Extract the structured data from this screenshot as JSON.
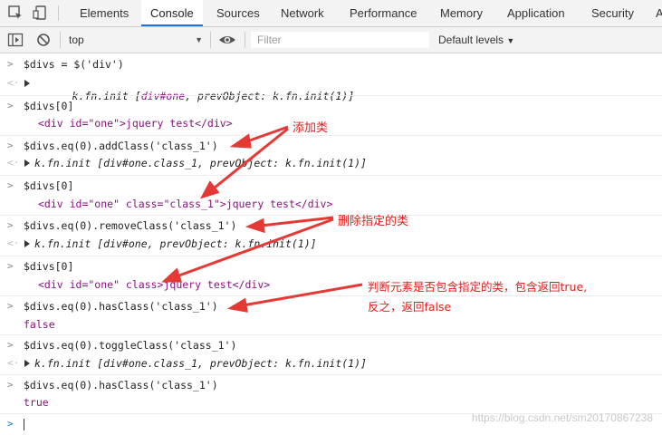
{
  "tabs": [
    "Elements",
    "Console",
    "Sources",
    "Network",
    "Performance",
    "Memory",
    "Application",
    "Security",
    "A"
  ],
  "toolbar": {
    "context": "top",
    "filter_placeholder": "Filter",
    "levels": "Default levels"
  },
  "console": {
    "l1": "$divs = $('div')",
    "l2a": "k.fn.init [",
    "l2b": "div#one",
    "l2c": ", prevObject: k.fn.init(1)]",
    "l3": "$divs[0]",
    "l4": "<div id=\"one\">jquery test</div>",
    "l5": "$divs.eq(0).addClass('class_1')",
    "l6": "k.fn.init [div#one.class_1, prevObject: k.fn.init(1)]",
    "l7": "$divs[0]",
    "l8": "<div id=\"one\" class=\"class_1\">jquery test</div>",
    "l9": "$divs.eq(0).removeClass('class_1')",
    "l10": "k.fn.init [div#one, prevObject: k.fn.init(1)]",
    "l11": "$divs[0]",
    "l12": "<div id=\"one\" class>jquery test</div>",
    "l13": "$divs.eq(0).hasClass('class_1')",
    "l14": "false",
    "l15": "$divs.eq(0).toggleClass('class_1')",
    "l16": "k.fn.init [div#one.class_1, prevObject: k.fn.init(1)]",
    "l17": "$divs.eq(0).hasClass('class_1')",
    "l18": "true"
  },
  "annotations": {
    "a1": "添加类",
    "a2": "删除指定的类",
    "a3_line1": "判断元素是否包含指定的类，包含返回true,",
    "a3_line2": "反之，返回false"
  },
  "watermark": "https://blog.csdn.net/sm20170867238",
  "colors": {
    "annotation": "#e02020",
    "active_tab": "#1a73e8"
  }
}
